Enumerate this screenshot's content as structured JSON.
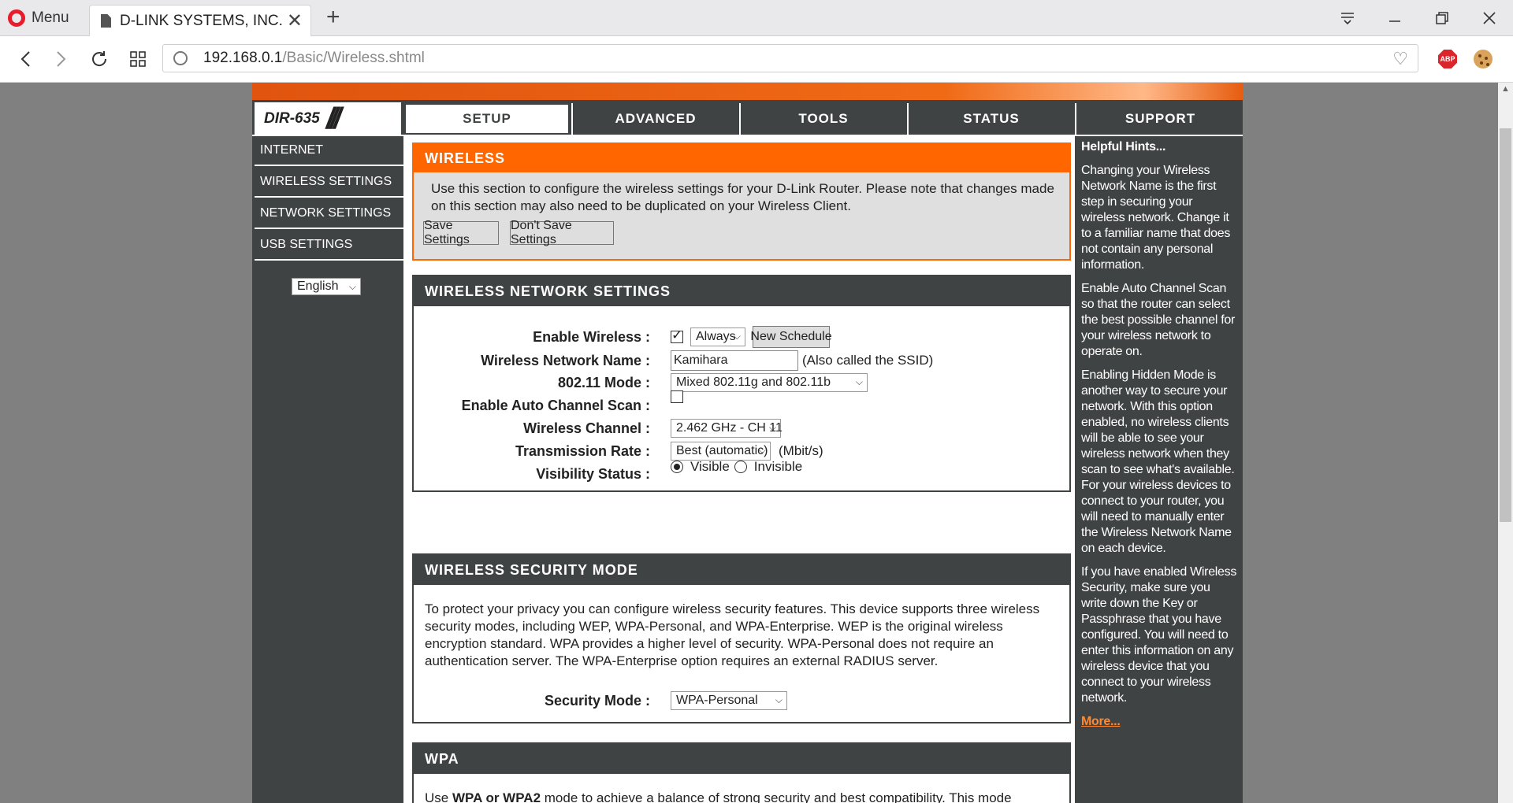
{
  "browser": {
    "menu_label": "Menu",
    "tab_title": "D-LINK SYSTEMS, INC. | WIRELESS",
    "url_host": "192.168.0.1",
    "url_path": "/Basic/Wireless.shtml"
  },
  "router": {
    "model": "DIR-635",
    "nav_tabs": [
      "SETUP",
      "ADVANCED",
      "TOOLS",
      "STATUS",
      "SUPPORT"
    ],
    "active_tab": "SETUP",
    "sidebar": [
      "INTERNET",
      "WIRELESS SETTINGS",
      "NETWORK SETTINGS",
      "USB SETTINGS"
    ],
    "language": "English"
  },
  "wireless": {
    "heading": "WIRELESS",
    "description": "Use this section to configure the wireless settings for your D-Link Router. Please note that changes made on this section may also need to be duplicated on your Wireless Client.",
    "save_label": "Save Settings",
    "dont_save_label": "Don't Save Settings"
  },
  "network_settings": {
    "heading": "WIRELESS NETWORK SETTINGS",
    "enable_wireless_label": "Enable Wireless :",
    "enable_wireless_checked": true,
    "schedule_value": "Always",
    "new_schedule_label": "New Schedule",
    "network_name_label": "Wireless Network Name :",
    "network_name_value": "Kamihara",
    "ssid_note": "(Also called the SSID)",
    "mode_label": "802.11 Mode :",
    "mode_value": "Mixed 802.11g and 802.11b",
    "auto_channel_label": "Enable Auto Channel Scan :",
    "auto_channel_checked": false,
    "channel_label": "Wireless Channel :",
    "channel_value": "2.462 GHz - CH 11",
    "rate_label": "Transmission Rate :",
    "rate_value": "Best (automatic)",
    "rate_unit": "(Mbit/s)",
    "visibility_label": "Visibility Status :",
    "visible_label": "Visible",
    "invisible_label": "Invisible",
    "visibility_value": "Visible"
  },
  "security": {
    "heading": "WIRELESS SECURITY MODE",
    "description": "To protect your privacy you can configure wireless security features. This device supports three wireless security modes, including WEP, WPA-Personal, and WPA-Enterprise. WEP is the original wireless encryption standard. WPA provides a higher level of security. WPA-Personal does not require an authentication server. The WPA-Enterprise option requires an external RADIUS server.",
    "mode_label": "Security Mode :",
    "mode_value": "WPA-Personal"
  },
  "wpa": {
    "heading": "WPA",
    "desc_pre": "Use ",
    "desc_bold": "WPA or WPA2",
    "desc_post": " mode to achieve a balance of strong security and best compatibility. This mode"
  },
  "hints": {
    "title": "Helpful Hints...",
    "p1": "Changing your Wireless Network Name is the first step in securing your wireless network. Change it to a familiar name that does not contain any personal information.",
    "p2": "Enable Auto Channel Scan so that the router can select the best possible channel for your wireless network to operate on.",
    "p3": "Enabling Hidden Mode is another way to secure your network. With this option enabled, no wireless clients will be able to see your wireless network when they scan to see what's available. For your wireless devices to connect to your router, you will need to manually enter the Wireless Network Name on each device.",
    "p4": "If you have enabled Wireless Security, make sure you write down the Key or Passphrase that you have configured. You will need to enter this information on any wireless device that you connect to your wireless network.",
    "more": "More..."
  }
}
